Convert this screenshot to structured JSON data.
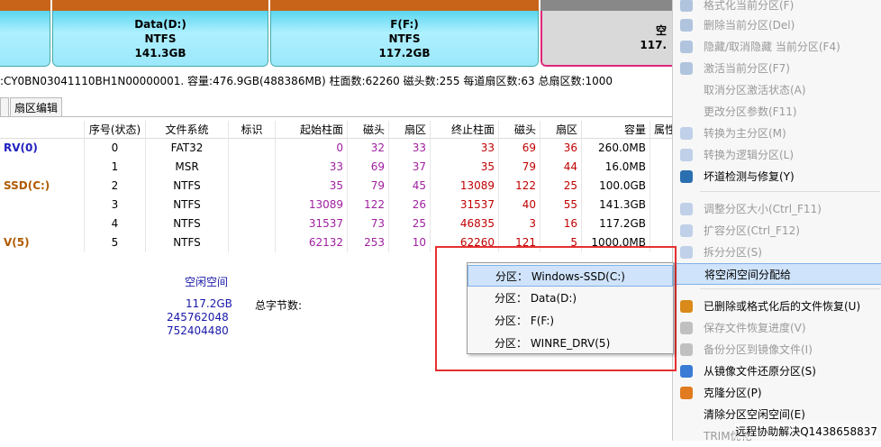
{
  "partitions": [
    {
      "name": "Data(D:)",
      "fs": "NTFS",
      "size": "141.3GB"
    },
    {
      "name": "F(F:)",
      "fs": "NTFS",
      "size": "117.2GB"
    },
    {
      "name": "空",
      "fs": "",
      "size": "117."
    }
  ],
  "disk_info": ":CY0BN03041110BH1N00000001. 容量:476.9GB(488386MB) 柱面数:62260 磁头数:255 每道扇区数:63 总扇区数:1000",
  "tabs": [
    "",
    "扇区编辑"
  ],
  "table": {
    "headers": [
      "",
      "序号(状态)",
      "文件系统",
      "标识",
      "起始柱面",
      "磁头",
      "扇区",
      "终止柱面",
      "磁头",
      "扇区",
      "容量",
      "属性"
    ],
    "rows": [
      {
        "name": "RV(0)",
        "no": "0",
        "fs": "FAT32",
        "flag": "",
        "sc": "0",
        "sh": "32",
        "ss": "33",
        "ec": "33",
        "eh": "69",
        "es": "36",
        "size": "260.0MB",
        "color": "blue"
      },
      {
        "name": "",
        "no": "1",
        "fs": "MSR",
        "flag": "",
        "sc": "33",
        "sh": "69",
        "ss": "37",
        "ec": "35",
        "eh": "79",
        "es": "44",
        "size": "16.0MB",
        "color": ""
      },
      {
        "name": "SSD(C:)",
        "no": "2",
        "fs": "NTFS",
        "flag": "",
        "sc": "35",
        "sh": "79",
        "ss": "45",
        "ec": "13089",
        "eh": "122",
        "es": "25",
        "size": "100.0GB",
        "color": "brown"
      },
      {
        "name": "",
        "no": "3",
        "fs": "NTFS",
        "flag": "",
        "sc": "13089",
        "sh": "122",
        "ss": "26",
        "ec": "31537",
        "eh": "40",
        "es": "55",
        "size": "141.3GB",
        "color": ""
      },
      {
        "name": "",
        "no": "4",
        "fs": "NTFS",
        "flag": "",
        "sc": "31537",
        "sh": "73",
        "ss": "25",
        "ec": "46835",
        "eh": "3",
        "es": "16",
        "size": "117.2GB",
        "color": ""
      },
      {
        "name": "V(5)",
        "no": "5",
        "fs": "NTFS",
        "flag": "",
        "sc": "62132",
        "sh": "253",
        "ss": "10",
        "ec": "62260",
        "eh": "121",
        "es": "5",
        "size": "1000.0MB",
        "color": "brown"
      }
    ]
  },
  "details": {
    "free_label": "空闲空间",
    "size": "117.2GB",
    "num1": "245762048",
    "num2": "752404480",
    "total_bytes_label": "总字节数:"
  },
  "context_menu": {
    "items": [
      {
        "label": "格式化当前分区(F)",
        "disabled": true
      },
      {
        "label": "删除当前分区(Del)",
        "disabled": true
      },
      {
        "label": "隐藏/取消隐藏 当前分区(F4)",
        "disabled": true
      },
      {
        "label": "激活当前分区(F7)",
        "disabled": true
      },
      {
        "label": "取消分区激活状态(A)",
        "disabled": true
      },
      {
        "label": "更改分区参数(F11)",
        "disabled": true
      },
      {
        "label": "转换为主分区(M)",
        "disabled": true
      },
      {
        "label": "转换为逻辑分区(L)",
        "disabled": true
      },
      {
        "label": "坏道检测与修复(Y)",
        "disabled": false
      },
      {
        "label": "调整分区大小(Ctrl_F11)",
        "disabled": true
      },
      {
        "label": "扩容分区(Ctrl_F12)",
        "disabled": true
      },
      {
        "label": "拆分分区(S)",
        "disabled": true
      },
      {
        "label": "将空闲空间分配给",
        "disabled": false
      },
      {
        "label": "已删除或格式化后的文件恢复(U)",
        "disabled": false
      },
      {
        "label": "保存文件恢复进度(V)",
        "disabled": true
      },
      {
        "label": "备份分区到镜像文件(I)",
        "disabled": true
      },
      {
        "label": "从镜像文件还原分区(S)",
        "disabled": false
      },
      {
        "label": "克隆分区(P)",
        "disabled": false
      },
      {
        "label": "清除分区空闲空间(E)",
        "disabled": false
      },
      {
        "label": "TRIM优化",
        "disabled": true
      }
    ]
  },
  "submenu": {
    "items": [
      "分区：  Windows-SSD(C:)",
      "分区：  Data(D:)",
      "分区：  F(F:)",
      "分区：  WINRE_DRV(5)"
    ]
  },
  "watermark": "远程协助解决Q1438658837"
}
